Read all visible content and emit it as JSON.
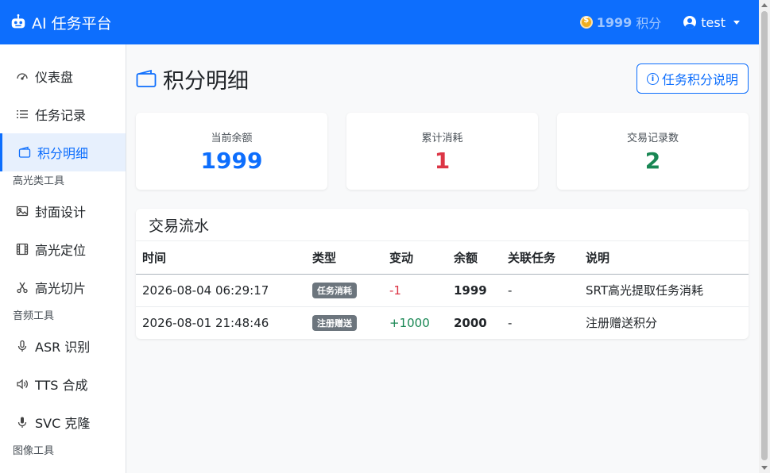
{
  "navbar": {
    "brand": "AI 任务平台",
    "points_value": "1999",
    "points_unit": "积分",
    "username": "test"
  },
  "sidebar": {
    "items": [
      {
        "label": "仪表盘",
        "icon": "speedometer-icon"
      },
      {
        "label": "任务记录",
        "icon": "list-icon"
      },
      {
        "label": "积分明细",
        "icon": "wallet-icon",
        "active": true
      }
    ],
    "section_highlight": "高光类工具",
    "highlight_items": [
      {
        "label": "封面设计",
        "icon": "image-icon"
      },
      {
        "label": "高光定位",
        "icon": "film-icon"
      },
      {
        "label": "高光切片",
        "icon": "scissors-icon"
      }
    ],
    "section_audio": "音频工具",
    "audio_items": [
      {
        "label": "ASR 识别",
        "icon": "mic-icon"
      },
      {
        "label": "TTS 合成",
        "icon": "volume-icon"
      },
      {
        "label": "SVC 克隆",
        "icon": "mic-fill-icon"
      }
    ],
    "section_image": "图像工具"
  },
  "page": {
    "title": "积分明细",
    "help_button": "任务积分说明"
  },
  "stats": [
    {
      "label": "当前余额",
      "value": "1999",
      "color": "#0d6efd"
    },
    {
      "label": "累计消耗",
      "value": "1",
      "color": "#dc3545"
    },
    {
      "label": "交易记录数",
      "value": "2",
      "color": "#198754"
    }
  ],
  "ledger": {
    "title": "交易流水",
    "columns": [
      "时间",
      "类型",
      "变动",
      "余额",
      "关联任务",
      "说明"
    ],
    "rows": [
      {
        "time": "2026-08-04 06:29:17",
        "type": "任务消耗",
        "change": "-1",
        "balance": "1999",
        "task": "-",
        "note": "SRT高光提取任务消耗"
      },
      {
        "time": "2026-08-01 21:48:46",
        "type": "注册赠送",
        "change": "+1000",
        "balance": "2000",
        "task": "-",
        "note": "注册赠送积分"
      }
    ]
  }
}
